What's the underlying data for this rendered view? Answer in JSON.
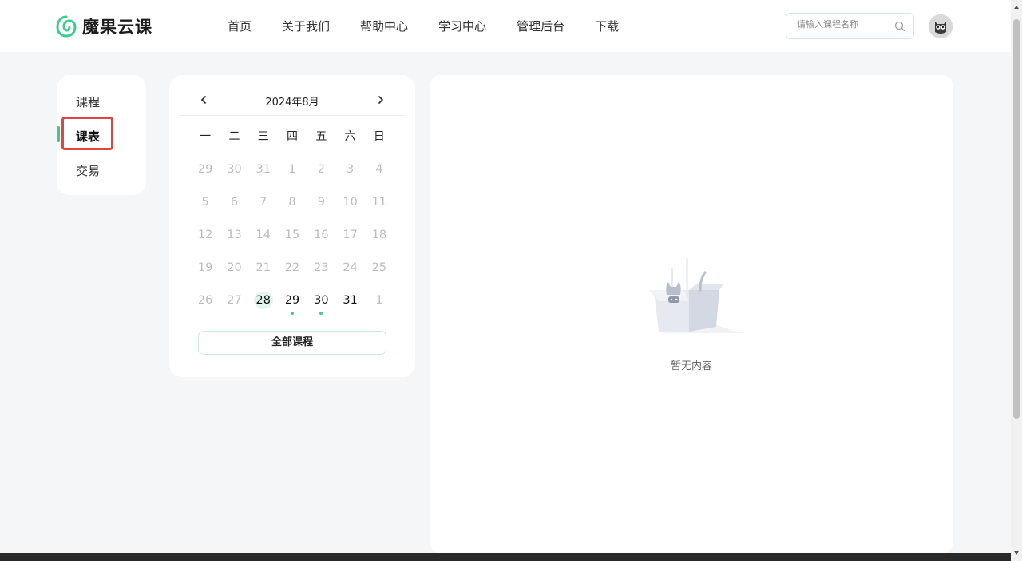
{
  "header": {
    "brand": "魔果云课",
    "nav": [
      "首页",
      "关于我们",
      "帮助中心",
      "学习中心",
      "管理后台",
      "下载"
    ],
    "search_placeholder": "请输入课程名称"
  },
  "sidebar": {
    "items": [
      {
        "label": "课程",
        "active": false
      },
      {
        "label": "课表",
        "active": true
      },
      {
        "label": "交易",
        "active": false
      }
    ]
  },
  "calendar": {
    "title": "2024年8月",
    "weekdays": [
      "一",
      "二",
      "三",
      "四",
      "五",
      "六",
      "日"
    ],
    "days": [
      {
        "d": "29",
        "cur": false
      },
      {
        "d": "30",
        "cur": false
      },
      {
        "d": "31",
        "cur": false
      },
      {
        "d": "1",
        "cur": false
      },
      {
        "d": "2",
        "cur": false
      },
      {
        "d": "3",
        "cur": false
      },
      {
        "d": "4",
        "cur": false
      },
      {
        "d": "5",
        "cur": false
      },
      {
        "d": "6",
        "cur": false
      },
      {
        "d": "7",
        "cur": false
      },
      {
        "d": "8",
        "cur": false
      },
      {
        "d": "9",
        "cur": false
      },
      {
        "d": "10",
        "cur": false
      },
      {
        "d": "11",
        "cur": false
      },
      {
        "d": "12",
        "cur": false
      },
      {
        "d": "13",
        "cur": false
      },
      {
        "d": "14",
        "cur": false
      },
      {
        "d": "15",
        "cur": false
      },
      {
        "d": "16",
        "cur": false
      },
      {
        "d": "17",
        "cur": false
      },
      {
        "d": "18",
        "cur": false
      },
      {
        "d": "19",
        "cur": false
      },
      {
        "d": "20",
        "cur": false
      },
      {
        "d": "21",
        "cur": false
      },
      {
        "d": "22",
        "cur": false
      },
      {
        "d": "23",
        "cur": false
      },
      {
        "d": "24",
        "cur": false
      },
      {
        "d": "25",
        "cur": false
      },
      {
        "d": "26",
        "cur": false
      },
      {
        "d": "27",
        "cur": false
      },
      {
        "d": "28",
        "cur": true,
        "today": true
      },
      {
        "d": "29",
        "cur": true,
        "dot": true
      },
      {
        "d": "30",
        "cur": true,
        "dot": true
      },
      {
        "d": "31",
        "cur": true
      },
      {
        "d": "1",
        "cur": false
      }
    ],
    "all_courses_button": "全部课程"
  },
  "content": {
    "empty_text": "暂无内容"
  },
  "colors": {
    "accent": "#3dcc8e",
    "highlight_box": "#e0463f"
  }
}
